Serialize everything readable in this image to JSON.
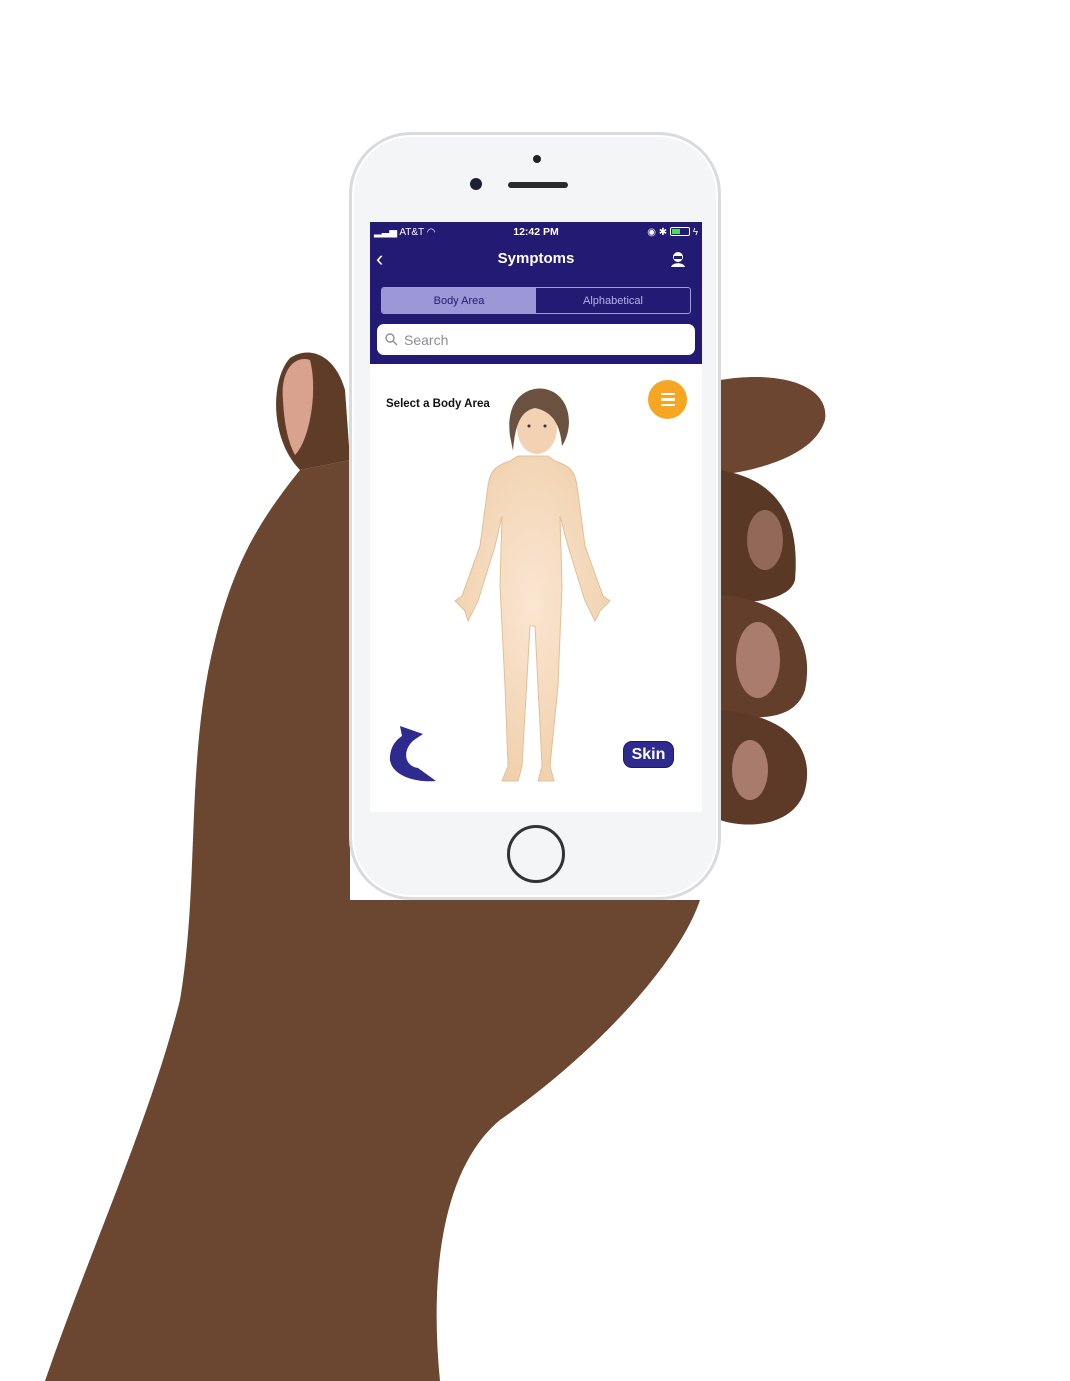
{
  "status_bar": {
    "carrier": "AT&T",
    "time": "12:42 PM"
  },
  "nav": {
    "title": "Symptoms",
    "back_icon": "chevron-left-icon",
    "profile_icon": "user-icon"
  },
  "segments": [
    {
      "label": "Body Area",
      "selected": true
    },
    {
      "label": "Alphabetical",
      "selected": false
    }
  ],
  "search": {
    "placeholder": "Search"
  },
  "content": {
    "prompt": "Select a Body Area",
    "skin_label": "Skin",
    "menu_icon": "hamburger-icon",
    "rotate_icon": "rotate-arrow-icon"
  },
  "colors": {
    "header": "#221a73",
    "segment_selected": "#9c98d8",
    "menu_button": "#f5a623",
    "skin_button": "#2e2a8e"
  }
}
